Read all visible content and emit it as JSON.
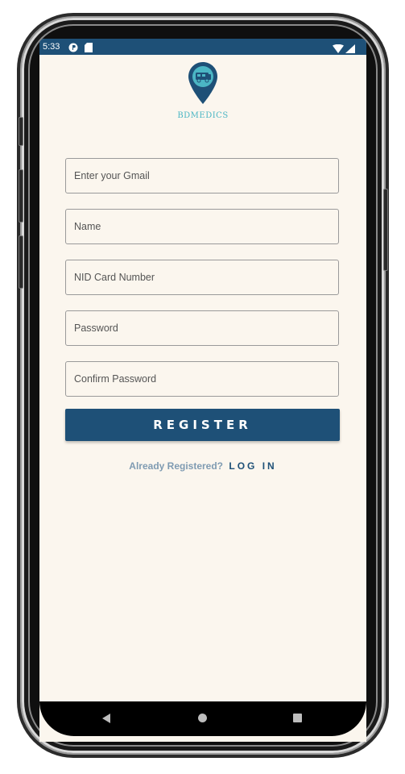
{
  "status_bar": {
    "time": "5:33"
  },
  "app": {
    "logo_text": "BDMEDICS"
  },
  "form": {
    "gmail_placeholder": "Enter your Gmail",
    "name_placeholder": "Name",
    "nid_placeholder": "NID Card Number",
    "password_placeholder": "Password",
    "confirm_password_placeholder": "Confirm Password",
    "register_label": "REGISTER",
    "already_registered_text": "Already Registered?",
    "login_label": "LOG IN"
  },
  "colors": {
    "primary": "#1e5077",
    "background": "#fbf6ee",
    "logo_accent": "#4bb6c4"
  },
  "icons": [
    "notification-icon",
    "sd-card-icon",
    "wifi-icon",
    "signal-icon",
    "location-pin-van-icon",
    "back-icon",
    "home-icon",
    "recents-icon"
  ]
}
